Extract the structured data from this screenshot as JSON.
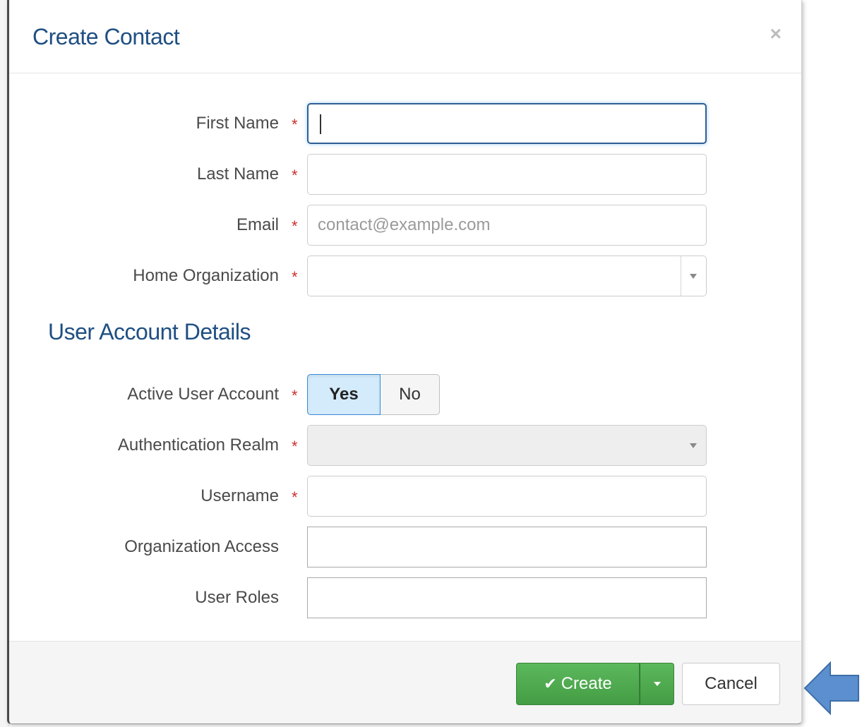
{
  "modal": {
    "title": "Create Contact",
    "close_glyph": "×"
  },
  "required_mark": "*",
  "form": {
    "first_name": {
      "label": "First Name",
      "value": ""
    },
    "last_name": {
      "label": "Last Name",
      "value": ""
    },
    "email": {
      "label": "Email",
      "placeholder": "contact@example.com"
    },
    "home_org": {
      "label": "Home Organization",
      "value": ""
    }
  },
  "section": {
    "title": "User Account Details"
  },
  "account": {
    "active": {
      "label": "Active User Account",
      "yes": "Yes",
      "no": "No",
      "selected": "Yes"
    },
    "realm": {
      "label": "Authentication Realm",
      "value": ""
    },
    "username": {
      "label": "Username",
      "value": ""
    },
    "org_access": {
      "label": "Organization Access",
      "value": ""
    },
    "user_roles": {
      "label": "User Roles",
      "value": ""
    }
  },
  "footer": {
    "create_label": "Create",
    "create_icon": "check-icon",
    "cancel_label": "Cancel"
  },
  "colors": {
    "title": "#1f4f82",
    "required": "#c9302c",
    "create_button": "#5cb85c",
    "annotation_arrow": "#5b8fd0"
  }
}
